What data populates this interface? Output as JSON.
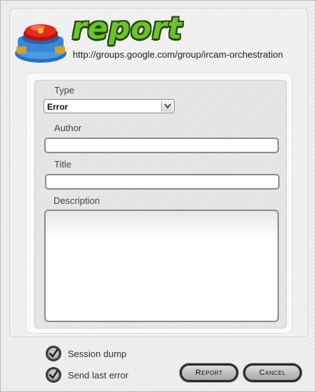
{
  "header": {
    "title": "report",
    "url": "http://groups.google.com/group/ircam-orchestration"
  },
  "form": {
    "type_label": "Type",
    "type_value": "Error",
    "author_label": "Author",
    "author_value": "",
    "title_label": "Title",
    "title_value": "",
    "description_label": "Description",
    "description_value": ""
  },
  "options": {
    "session_dump": {
      "label": "Session dump",
      "checked": true
    },
    "send_last_error": {
      "label": "Send last error",
      "checked": true
    }
  },
  "buttons": {
    "report": "Report",
    "cancel": "Cancel"
  },
  "colors": {
    "brand_green": "#6cc22c",
    "brand_outline": "#234a0b",
    "button_border": "#2b2b2b"
  }
}
